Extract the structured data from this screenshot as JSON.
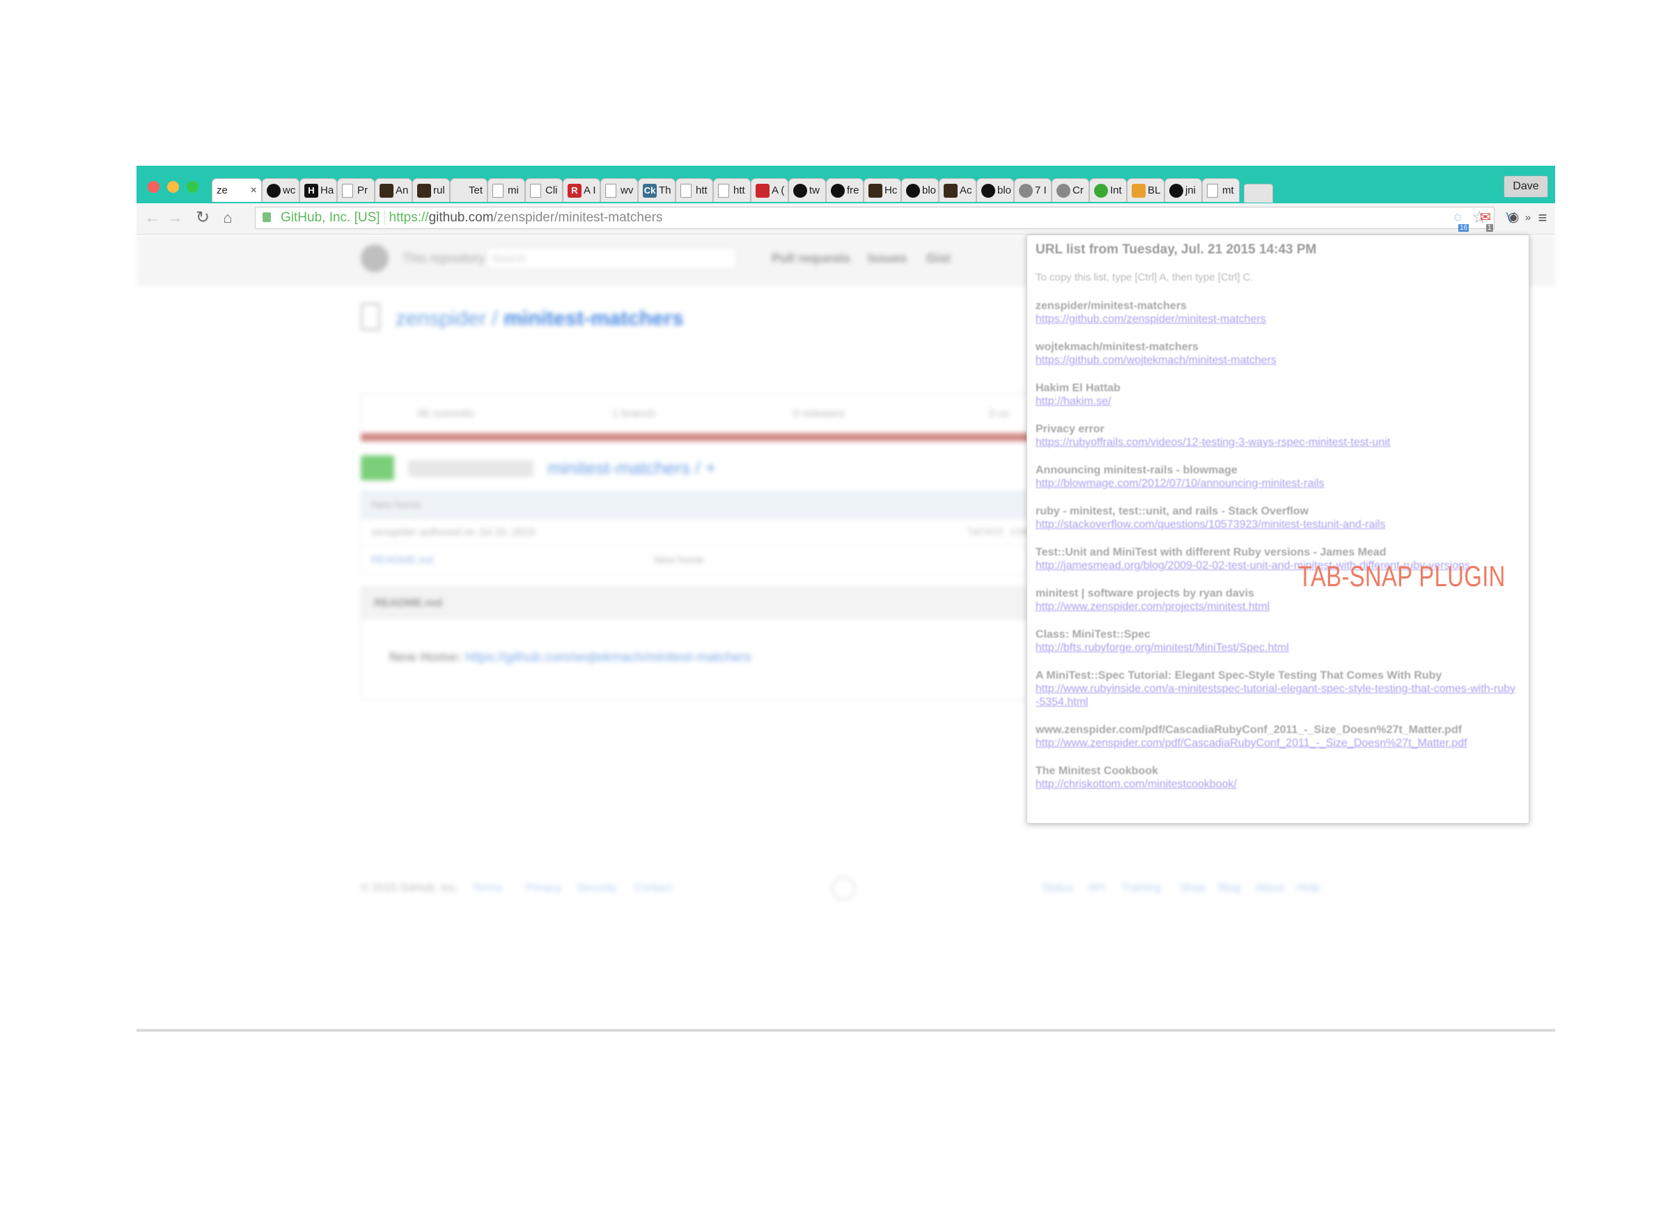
{
  "browser": {
    "profile_name": "Dave",
    "active_tab": {
      "label": "ze",
      "close": "×"
    },
    "tabs": [
      {
        "label": "wc",
        "icon": "github-icon"
      },
      {
        "label": "Ha",
        "icon": "hacker-icon",
        "glyph": "H"
      },
      {
        "label": "Pr",
        "icon": "page-icon"
      },
      {
        "label": "An",
        "icon": "site-icon"
      },
      {
        "label": "rul",
        "icon": "site-icon"
      },
      {
        "label": "Tet",
        "icon": "none"
      },
      {
        "label": "mi",
        "icon": "page-icon"
      },
      {
        "label": "Cli",
        "icon": "page-icon"
      },
      {
        "label": "A I",
        "icon": "red-icon",
        "glyph": "R"
      },
      {
        "label": "wv",
        "icon": "page-icon"
      },
      {
        "label": "Th",
        "icon": "ck-icon",
        "glyph": "Ck"
      },
      {
        "label": "htt",
        "icon": "page-icon"
      },
      {
        "label": "htt",
        "icon": "page-icon"
      },
      {
        "label": "A (",
        "icon": "ruby-icon"
      },
      {
        "label": "tw",
        "icon": "github-icon"
      },
      {
        "label": "fre",
        "icon": "github-icon"
      },
      {
        "label": "Hc",
        "icon": "site-icon"
      },
      {
        "label": "blo",
        "icon": "github-icon"
      },
      {
        "label": "Ac",
        "icon": "site-icon"
      },
      {
        "label": "blo",
        "icon": "github-icon"
      },
      {
        "label": "7 I",
        "icon": "avatar-icon"
      },
      {
        "label": "Cr",
        "icon": "c-icon"
      },
      {
        "label": "Int",
        "icon": "green-icon"
      },
      {
        "label": "BL",
        "icon": "bug-icon"
      },
      {
        "label": "jni",
        "icon": "github-icon"
      },
      {
        "label": "mt",
        "icon": "page-icon"
      }
    ],
    "omnibox": {
      "ev_label": "GitHub, Inc. [US]",
      "scheme": "https://",
      "host": "github.com",
      "path": "/zenspider/minitest-matchers"
    },
    "ext_badges": {
      "first": "16",
      "second": "1"
    }
  },
  "page": {
    "header": {
      "scope": "This repository",
      "search_placeholder": "Search",
      "nav": [
        "Pull requests",
        "Issues",
        "Gist"
      ]
    },
    "repo": {
      "owner": "zenspider",
      "separator": "/",
      "name": "minitest-matchers"
    },
    "stats": [
      "46 commits",
      "1 branch",
      "0 releases",
      "3 co"
    ],
    "breadcrumb": "minitest-matchers / +",
    "commitbar": "New home",
    "rows": [
      {
        "name": "zenspider",
        "message": "authored on Jul 20, 2015",
        "right": "latest comm"
      },
      {
        "name": "README.md",
        "message": "New home"
      }
    ],
    "readme": {
      "heading": "README.md",
      "text": "New Home:",
      "link": "https://github.com/wojtekmach/minitest-matchers"
    },
    "footer": {
      "left": [
        "© 2015 GitHub, Inc.",
        "Terms",
        "Privacy",
        "Security",
        "Contact"
      ],
      "right": [
        "Status",
        "API",
        "Training",
        "Shop",
        "Blog",
        "About",
        "Help"
      ]
    }
  },
  "popup": {
    "title": "URL list from Tuesday, Jul. 21 2015 14:43 PM",
    "hint": "To copy this list, type [Ctrl] A, then type [Ctrl] C.",
    "entries": [
      {
        "title": "zenspider/minitest-matchers",
        "url": "https://github.com/zenspider/minitest-matchers"
      },
      {
        "title": "wojtekmach/minitest-matchers",
        "url": "https://github.com/wojtekmach/minitest-matchers"
      },
      {
        "title": "Hakim El Hattab",
        "url": "http://hakim.se/"
      },
      {
        "title": "Privacy error",
        "url": "https://rubyoffrails.com/videos/12-testing-3-ways-rspec-minitest-test-unit"
      },
      {
        "title": "Announcing minitest-rails - blowmage",
        "url": "http://blowmage.com/2012/07/10/announcing-minitest-rails"
      },
      {
        "title": "ruby - minitest, test::unit, and rails - Stack Overflow",
        "url": "http://stackoverflow.com/questions/10573923/minitest-testunit-and-rails"
      },
      {
        "title": "Test::Unit and MiniTest with different Ruby versions - James Mead",
        "url": "http://jamesmead.org/blog/2009-02-02-test-unit-and-minitest-with-different-ruby-versions"
      },
      {
        "title": "minitest | software projects by ryan davis",
        "url": "http://www.zenspider.com/projects/minitest.html"
      },
      {
        "title": "Class: MiniTest::Spec",
        "url": "http://bfts.rubyforge.org/minitest/MiniTest/Spec.html"
      },
      {
        "title": "A MiniTest::Spec Tutorial: Elegant Spec-Style Testing That Comes With Ruby",
        "url": "http://www.rubyinside.com/a-minitestspec-tutorial-elegant-spec-style-testing-that-comes-with-ruby-5354.html"
      },
      {
        "title": "www.zenspider.com/pdf/CascadiaRubyConf_2011_-_Size_Doesn%27t_Matter.pdf",
        "url": "http://www.zenspider.com/pdf/CascadiaRubyConf_2011_-_Size_Doesn%27t_Matter.pdf"
      },
      {
        "title": "The Minitest Cookbook",
        "url": "http://chriskottom.com/minitestcookbook/"
      }
    ]
  },
  "annotation": {
    "label": "TAB-SNAP PLUGIN",
    "color": "#ef7b62"
  },
  "colors": {
    "tabstrip": "#26c7b0",
    "link": "#a9a0ef"
  }
}
